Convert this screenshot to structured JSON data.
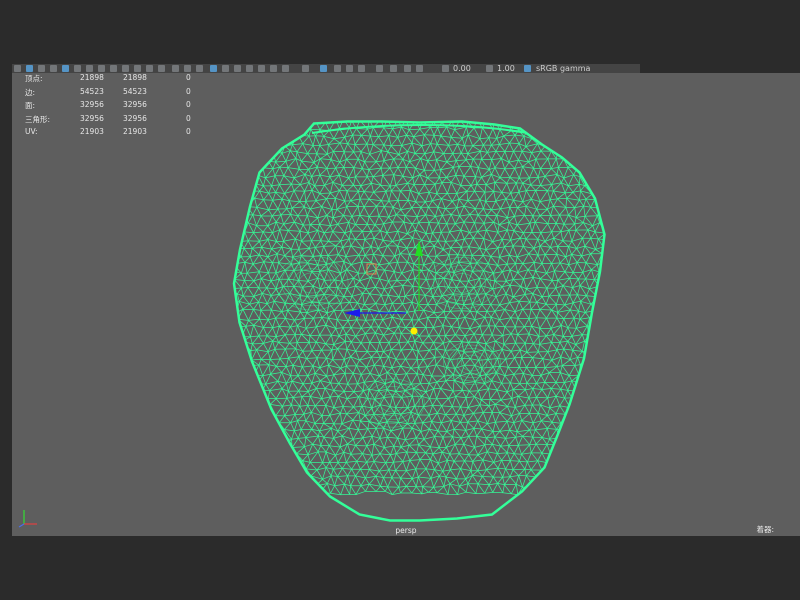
{
  "toolbar": {
    "field_a": "0.00",
    "field_b": "1.00",
    "color_mgmt_label": "sRGB gamma"
  },
  "stats": {
    "rows": [
      {
        "label": "顶点:",
        "v1": "21898",
        "v2": "21898",
        "v3": "0"
      },
      {
        "label": "边:",
        "v1": "54523",
        "v2": "54523",
        "v3": "0"
      },
      {
        "label": "面:",
        "v1": "32956",
        "v2": "32956",
        "v3": "0"
      },
      {
        "label": "三角形:",
        "v1": "32956",
        "v2": "32956",
        "v3": "0"
      },
      {
        "label": "UV:",
        "v1": "21903",
        "v2": "21903",
        "v3": "0"
      }
    ]
  },
  "viewport": {
    "camera_label": "persp",
    "corner_label": "着器:"
  },
  "colors": {
    "mesh": "#33ff99",
    "viewport_bg": "#5e5e5e",
    "frame_bg": "#2b2b2b",
    "manip_y": "#22dd22",
    "manip_x": "#1a1aee",
    "pivot": "#ffee00"
  },
  "icons": [
    "move-manipulator-icon",
    "axis-indicator-icon",
    "pivot-icon"
  ]
}
